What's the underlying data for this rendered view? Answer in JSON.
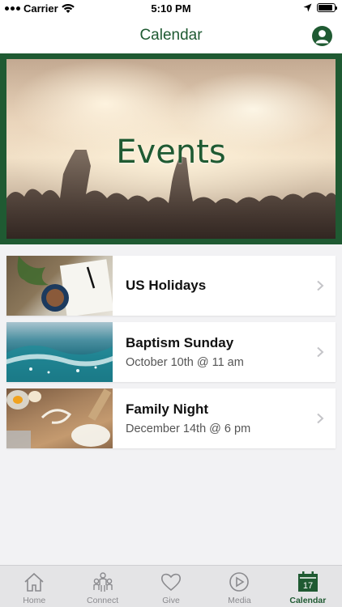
{
  "status_bar": {
    "carrier": "Carrier",
    "time": "5:10 PM",
    "battery_level": 0.9
  },
  "nav": {
    "title": "Calendar",
    "profile_icon": "person-icon"
  },
  "hero": {
    "title": "Events"
  },
  "events": [
    {
      "title": "US Holidays",
      "subtitle": "",
      "thumb": "notebook-coffee-image"
    },
    {
      "title": "Baptism Sunday",
      "subtitle": "October 10th @ 11 am",
      "thumb": "water-wave-image"
    },
    {
      "title": "Family Night",
      "subtitle": "December 14th @ 6 pm",
      "thumb": "family-flour-image"
    }
  ],
  "tabs": [
    {
      "label": "Home",
      "icon": "home-icon",
      "active": false
    },
    {
      "label": "Connect",
      "icon": "people-icon",
      "active": false
    },
    {
      "label": "Give",
      "icon": "heart-icon",
      "active": false
    },
    {
      "label": "Media",
      "icon": "play-icon",
      "active": false
    },
    {
      "label": "Calendar",
      "icon": "calendar-icon",
      "active": true,
      "calendar_day": "17"
    }
  ],
  "colors": {
    "brand_green": "#1f5a32",
    "tab_inactive": "#8a8a8e"
  }
}
